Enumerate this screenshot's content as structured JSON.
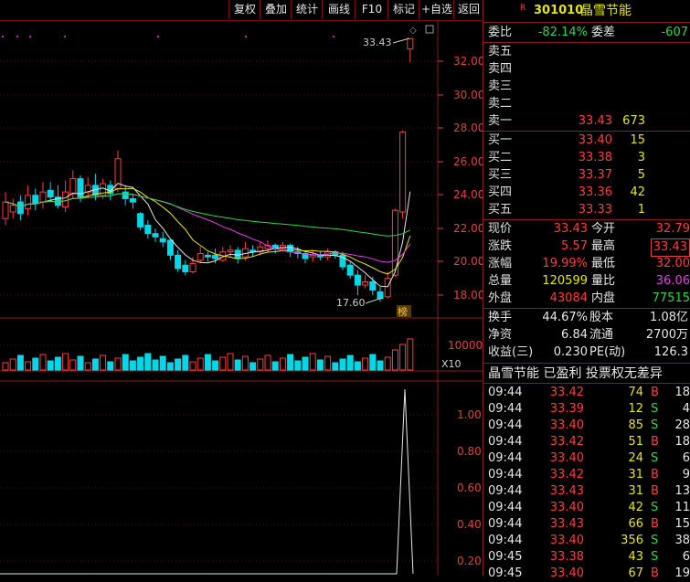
{
  "toolbar": {
    "buttons": [
      "复权",
      "叠加",
      "统计",
      "画线",
      "F10",
      "标记",
      "+自选",
      "返回"
    ]
  },
  "chart": {
    "price_ticks": [
      "32.00",
      "30.00",
      "28.00",
      "26.00",
      "24.00",
      "22.00",
      "20.00",
      "18.00"
    ],
    "high_annotation": "33.43",
    "low_annotation": "17.60",
    "bang_label": "榜",
    "volume_tick": "10000",
    "volume_unit": "X10",
    "indicator_ticks": [
      "1.00",
      "0.80",
      "0.60",
      "0.40",
      "0.20"
    ]
  },
  "chart_data": {
    "type": "candlestick",
    "price_axis": {
      "ylim": [
        17.0,
        34.0
      ],
      "ticks": [
        18,
        20,
        22,
        24,
        26,
        28,
        30,
        32
      ]
    },
    "labeled_points": {
      "high": 33.43,
      "low": 17.6
    },
    "volume_axis": {
      "tick": 10000,
      "unit": "X10"
    },
    "indicator_axis": {
      "ylim": [
        0,
        1.05
      ],
      "ticks": [
        0.2,
        0.4,
        0.6,
        0.8,
        1.0
      ]
    }
  },
  "quote": {
    "r_badge": "R",
    "code": "301010",
    "name": "晶雪节能",
    "weibi_label": "委比",
    "weibi_value": "-82.14%",
    "weicha_label": "委差",
    "weicha_value": "-607",
    "sell": [
      {
        "label": "卖五",
        "price": "",
        "vol": ""
      },
      {
        "label": "卖四",
        "price": "",
        "vol": ""
      },
      {
        "label": "卖三",
        "price": "",
        "vol": ""
      },
      {
        "label": "卖二",
        "price": "",
        "vol": ""
      },
      {
        "label": "卖一",
        "price": "33.43",
        "vol": "673"
      }
    ],
    "buy": [
      {
        "label": "买一",
        "price": "33.40",
        "vol": "15"
      },
      {
        "label": "买二",
        "price": "33.38",
        "vol": "3"
      },
      {
        "label": "买三",
        "price": "33.37",
        "vol": "5"
      },
      {
        "label": "买四",
        "price": "33.36",
        "vol": "42"
      },
      {
        "label": "买五",
        "price": "33.33",
        "vol": "1"
      }
    ],
    "stats": [
      {
        "l1": "现价",
        "v1": "33.43",
        "c1": "red",
        "l2": "今开",
        "v2": "32.79",
        "c2": "red"
      },
      {
        "l1": "涨跌",
        "v1": "5.57",
        "c1": "red",
        "l2": "最高",
        "v2": "33.43",
        "c2": "red"
      },
      {
        "l1": "涨幅",
        "v1": "19.99%",
        "c1": "red",
        "l2": "最低",
        "v2": "32.00",
        "c2": "red"
      },
      {
        "l1": "总量",
        "v1": "120599",
        "c1": "yellow",
        "l2": "量比",
        "v2": "36.06",
        "c2": "magenta"
      },
      {
        "l1": "外盘",
        "v1": "43084",
        "c1": "red",
        "l2": "内盘",
        "v2": "77515",
        "c2": "green"
      }
    ],
    "stats2": [
      {
        "l1": "换手",
        "v1": "44.67%",
        "l2": "股本",
        "v2": "1.08亿"
      },
      {
        "l1": "净资",
        "v1": "6.84",
        "l2": "流通",
        "v2": "2700万"
      },
      {
        "l1": "收益(三)",
        "v1": "0.230",
        "l2": "PE(动)",
        "v2": "126.3"
      }
    ],
    "company_line": "晶雪节能 已盈利 投票权无差异"
  },
  "ticks": [
    {
      "time": "09:44",
      "price": "33.42",
      "vol": "74",
      "bs": "B",
      "n": "18"
    },
    {
      "time": "09:44",
      "price": "33.39",
      "vol": "12",
      "bs": "S",
      "n": "4"
    },
    {
      "time": "09:44",
      "price": "33.40",
      "vol": "85",
      "bs": "S",
      "n": "28"
    },
    {
      "time": "09:44",
      "price": "33.42",
      "vol": "51",
      "bs": "B",
      "n": "18"
    },
    {
      "time": "09:44",
      "price": "33.40",
      "vol": "24",
      "bs": "S",
      "n": "6"
    },
    {
      "time": "09:44",
      "price": "33.42",
      "vol": "31",
      "bs": "B",
      "n": "9"
    },
    {
      "time": "09:44",
      "price": "33.43",
      "vol": "31",
      "bs": "B",
      "n": "13"
    },
    {
      "time": "09:44",
      "price": "33.40",
      "vol": "42",
      "bs": "S",
      "n": "11"
    },
    {
      "time": "09:44",
      "price": "33.43",
      "vol": "66",
      "bs": "B",
      "n": "15"
    },
    {
      "time": "09:44",
      "price": "33.40",
      "vol": "356",
      "bs": "S",
      "n": "38"
    },
    {
      "time": "09:45",
      "price": "33.38",
      "vol": "43",
      "bs": "S",
      "n": "6"
    },
    {
      "time": "09:45",
      "price": "33.40",
      "vol": "67",
      "bs": "B",
      "n": "19"
    }
  ]
}
